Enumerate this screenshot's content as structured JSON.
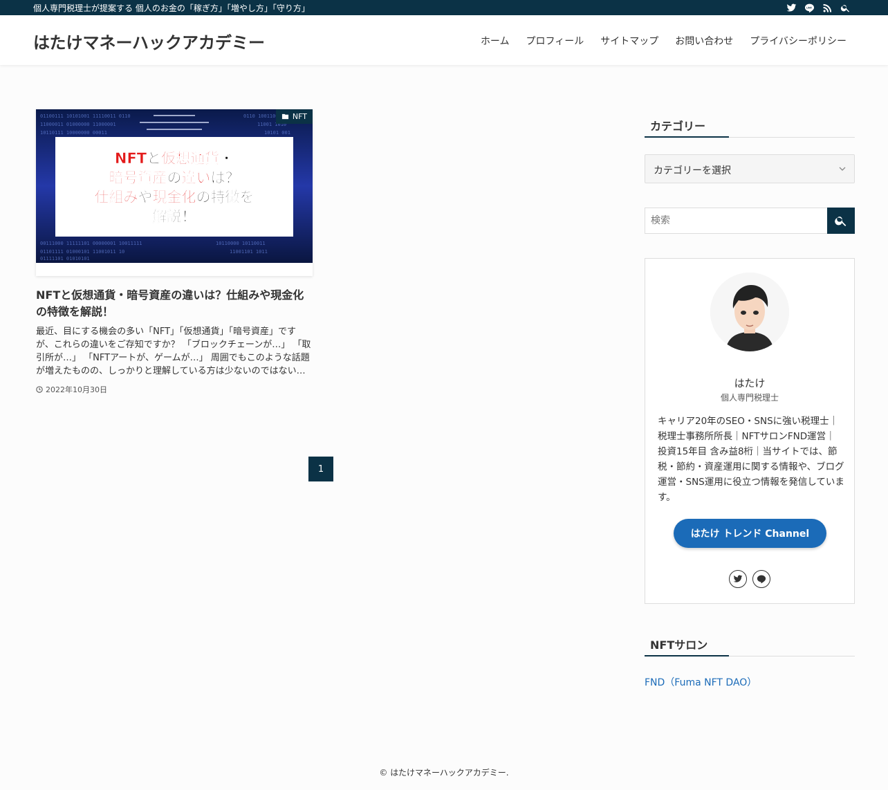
{
  "topbar": {
    "tagline": "個人専門税理士が提案する 個人のお金の「稼ぎ方」「増やし方」「守り方」",
    "icons": [
      "twitter-icon",
      "line-icon",
      "rss-icon",
      "search-icon"
    ]
  },
  "header": {
    "site_title": "はたけマネーハックアカデミー",
    "nav": [
      "ホーム",
      "プロフィール",
      "サイトマップ",
      "お問い合わせ",
      "プライバシーポリシー"
    ]
  },
  "post": {
    "category": "NFT",
    "thumb_lines": [
      "NFTと仮想通貨・",
      "暗号資産の違いは？",
      "仕組みや現金化の特徴を",
      "解説！"
    ],
    "title": "NFTと仮想通貨・暗号資産の違いは？仕組みや現金化の特徴を解説！",
    "excerpt": "最近、目にする機会の多い「NFT」「仮想通貨」「暗号資産」ですが、これらの違いをご存知ですか？ 「ブロックチェーンが…」 「取引所が…」 「NFTアートが、ゲームが…」 周囲でもこのような話題が増えたものの、しっかりと理解している方は少ないのではない…",
    "date": "2022年10月30日"
  },
  "pagination": {
    "current": "1"
  },
  "sidebar": {
    "category_title": "カテゴリー",
    "category_select": "カテゴリーを選択",
    "search_placeholder": "検索",
    "profile": {
      "name": "はたけ",
      "role": "個人専門税理士",
      "description": "キャリア20年のSEO・SNSに強い税理士｜税理士事務所所長｜NFTサロンFND運営｜投資15年目 含み益8桁｜当サイトでは、節税・節約・資産運用に関する情報や、ブログ運営・SNS運用に役立つ情報を発信しています。",
      "button": "はたけ トレンド Channel"
    },
    "nft_title": "NFTサロン",
    "nft_link": "FND（Fuma NFT DAO）"
  },
  "footer": {
    "copyright": "© はたけマネーハックアカデミー."
  },
  "colors": {
    "primary": "#0b3246",
    "accent": "#1b6bb8",
    "thumb_red": "#e31b1b"
  }
}
